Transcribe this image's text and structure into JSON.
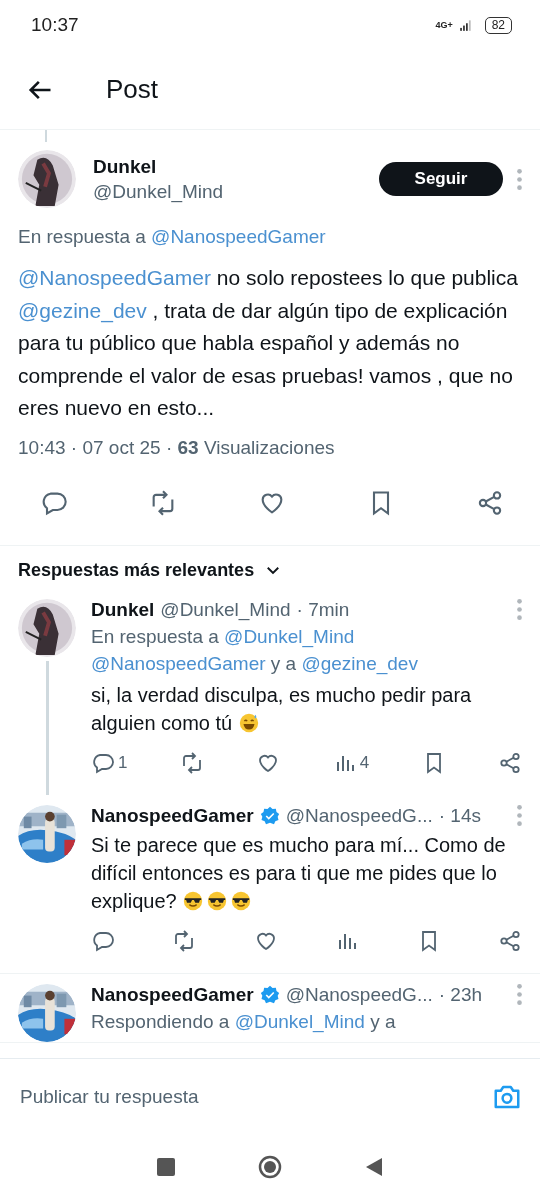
{
  "status_bar": {
    "time": "10:37",
    "network": "4G+",
    "battery": "82"
  },
  "header": {
    "title": "Post"
  },
  "post": {
    "name": "Dunkel",
    "handle": "@Dunkel_Mind",
    "follow_button": "Seguir",
    "reply_to": [
      {
        "kind": "plain",
        "text": "En respuesta a "
      },
      {
        "kind": "mention",
        "text": "@NanospeedGamer"
      }
    ],
    "body": [
      {
        "kind": "mention",
        "text": "@NanospeedGamer"
      },
      {
        "kind": "plain",
        "text": " no solo repostees lo que publica "
      },
      {
        "kind": "mention",
        "text": "@gezine_dev"
      },
      {
        "kind": "plain",
        "text": " , trata de dar algún tipo de explicación para tu público que habla español y además no comprende el valor de esas pruebas! vamos , que no eres nuevo en esto..."
      }
    ],
    "meta": "10:43 · 07 oct 25 · **63** Visualizaciones"
  },
  "replies_sort": {
    "label": "Respuestas más relevantes"
  },
  "replies": [
    {
      "name": "Dunkel",
      "verified": false,
      "handle": "@Dunkel_Mind",
      "time": "· 7min",
      "thread_line": true,
      "reply_to": [
        {
          "kind": "plain",
          "text": "En respuesta a "
        },
        {
          "kind": "mention",
          "text": "@Dunkel_Mind"
        },
        {
          "kind": "mention",
          "text": "@NanospeedGamer"
        },
        {
          "kind": "plain",
          "text": " y a "
        },
        {
          "kind": "mention",
          "text": "@gezine_dev"
        }
      ],
      "body": [
        {
          "kind": "plain",
          "text": "si, la verdad disculpa, es mucho pedir para alguien como tú "
        },
        {
          "kind": "sweat-smile-emoji"
        }
      ],
      "reply_count": "1",
      "view_count": "4"
    },
    {
      "name": "NanospeedGamer",
      "verified": true,
      "handle": "@NanospeedG...",
      "time": "· 14s",
      "thread_line": false,
      "body": [
        {
          "kind": "plain",
          "text": "Si te parece que es mucho para mí... Como de difícil entonces es para ti que me pides que lo explique? "
        },
        {
          "kind": "sunglasses-emoji"
        },
        {
          "kind": "sunglasses-emoji"
        },
        {
          "kind": "sunglasses-emoji"
        }
      ]
    },
    {
      "name": "NanospeedGamer",
      "verified": true,
      "handle": "@NanospeedG...",
      "time": "· 23h",
      "thread_line": false,
      "reply_to": [
        {
          "kind": "plain",
          "text": "Respondiendo a "
        },
        {
          "kind": "mention",
          "text": "@Dunkel_Mind"
        },
        {
          "kind": "plain",
          "text": " y a"
        }
      ]
    }
  ],
  "composer": {
    "placeholder": "Publicar tu respuesta"
  }
}
